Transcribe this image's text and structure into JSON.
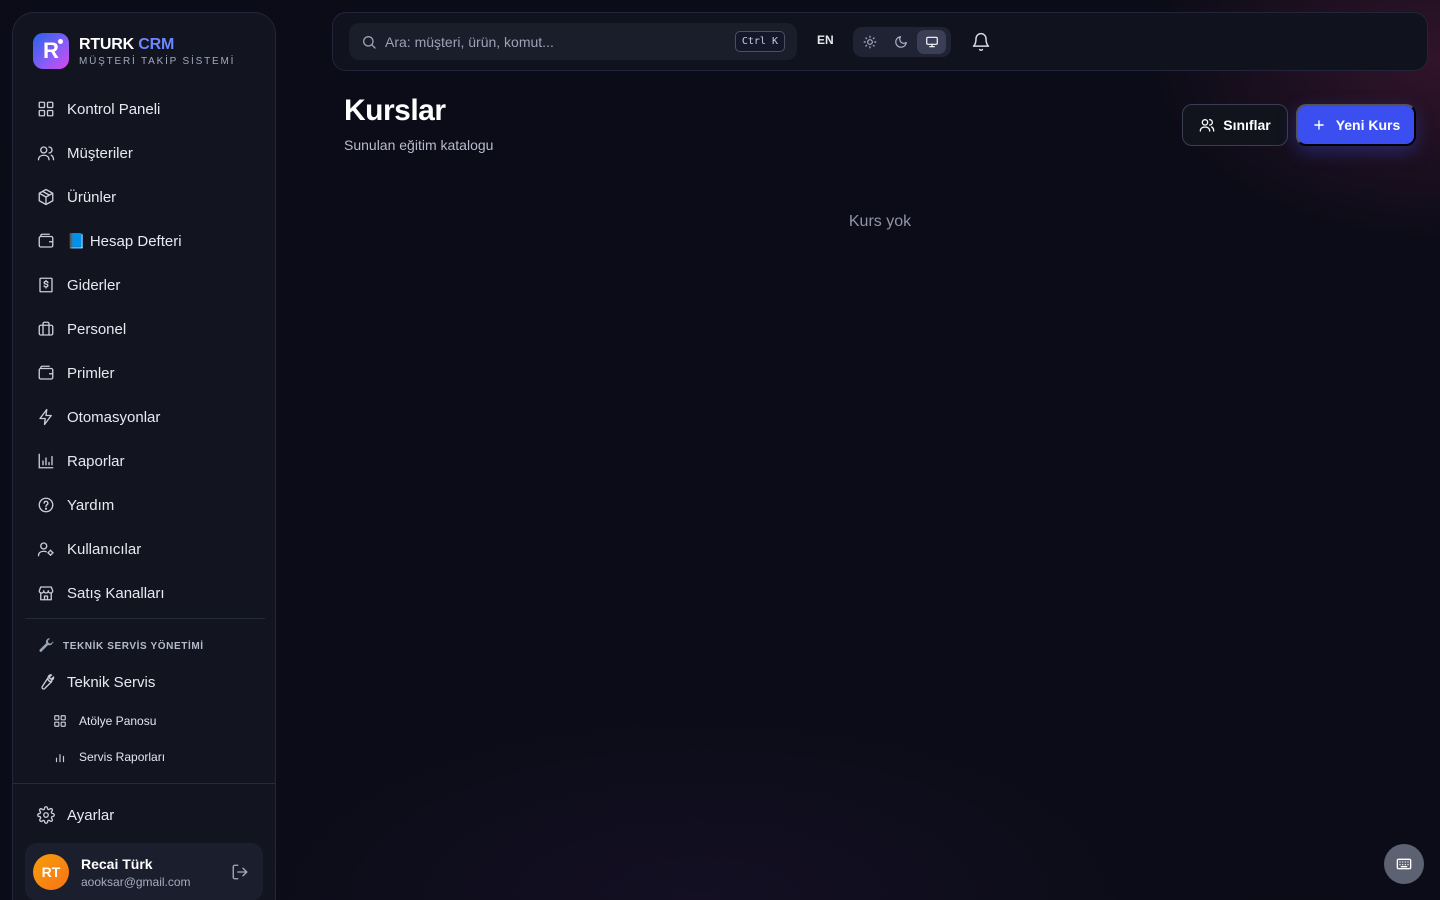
{
  "brand": {
    "logo_letter": "R",
    "title_part1": "RTURK",
    "title_part2": "CRM",
    "subtitle": "MÜŞTERİ TAKİP SİSTEMİ"
  },
  "sidebar": {
    "items": [
      {
        "label": "Kontrol Paneli",
        "icon": "grid-icon"
      },
      {
        "label": "Müşteriler",
        "icon": "users-icon"
      },
      {
        "label": "Ürünler",
        "icon": "package-icon"
      },
      {
        "label": "📘 Hesap Defteri",
        "icon": "wallet-icon"
      },
      {
        "label": "Giderler",
        "icon": "receipt-icon"
      },
      {
        "label": "Personel",
        "icon": "briefcase-icon"
      },
      {
        "label": "Primler",
        "icon": "wallet-icon"
      },
      {
        "label": "Otomasyonlar",
        "icon": "lightning-icon"
      },
      {
        "label": "Raporlar",
        "icon": "bar-chart-icon"
      },
      {
        "label": "Yardım",
        "icon": "help-circle-icon"
      },
      {
        "label": "Kullanıcılar",
        "icon": "user-cog-icon"
      },
      {
        "label": "Satış Kanalları",
        "icon": "store-icon"
      }
    ],
    "section_label": "TEKNİK SERVİS YÖNETİMİ",
    "service_item": {
      "label": "Teknik Servis",
      "icon": "wrench-icon"
    },
    "sub_items": [
      {
        "label": "Atölye Panosu",
        "icon": "grid-icon"
      },
      {
        "label": "Servis Raporları",
        "icon": "bar-chart-icon"
      }
    ],
    "settings_label": "Ayarlar"
  },
  "user": {
    "initials": "RT",
    "name": "Recai Türk",
    "email": "aooksar@gmail.com"
  },
  "topbar": {
    "search_placeholder": "Ara: müşteri, ürün, komut...",
    "shortcut": "Ctrl K",
    "language": "EN",
    "theme_options": [
      "light",
      "dark",
      "system"
    ],
    "theme_selected": "system"
  },
  "page": {
    "title": "Kurslar",
    "subtitle": "Sunulan eğitim katalogu",
    "secondary_button": "Sınıflar",
    "primary_button": "Yeni Kurs",
    "empty_text": "Kurs yok"
  },
  "colors": {
    "accent": "#3b4ef0",
    "brand_blue": "#6b86ff",
    "background": "#0b0c17",
    "sidebar_bg": "#12141f"
  }
}
